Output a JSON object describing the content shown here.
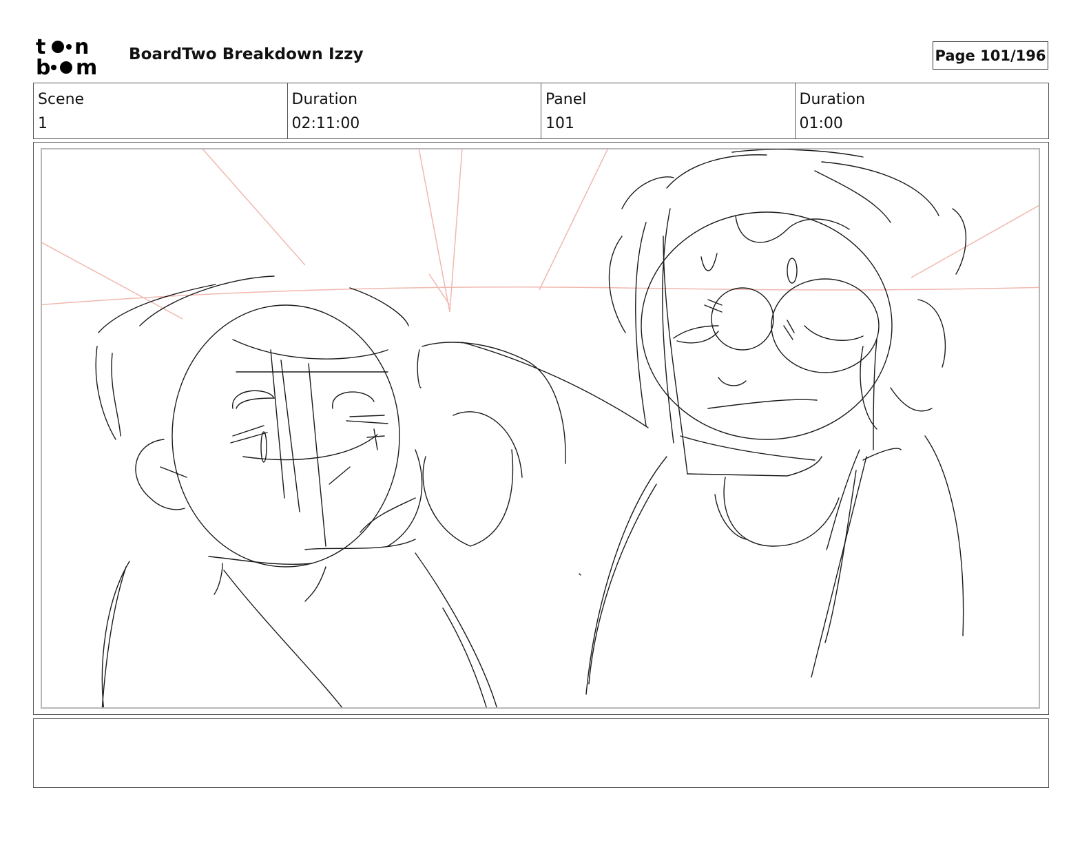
{
  "header": {
    "logo_text": [
      "to.on",
      "bo.om"
    ],
    "title": "BoardTwo Breakdown Izzy",
    "page": "Page 101/196"
  },
  "info": {
    "scene_label": "Scene",
    "scene_value": "1",
    "scene_duration_label": "Duration",
    "scene_duration_value": "02:11:00",
    "panel_label": "Panel",
    "panel_value": "101",
    "panel_duration_label": "Duration",
    "panel_duration_value": "01:00"
  },
  "notes": {
    "text": ""
  },
  "colors": {
    "sketch_line": "#1a1a1a",
    "perspective_line": "#f0b8ae",
    "frame_border": "#555555",
    "inner_border": "#b8b8b8"
  }
}
